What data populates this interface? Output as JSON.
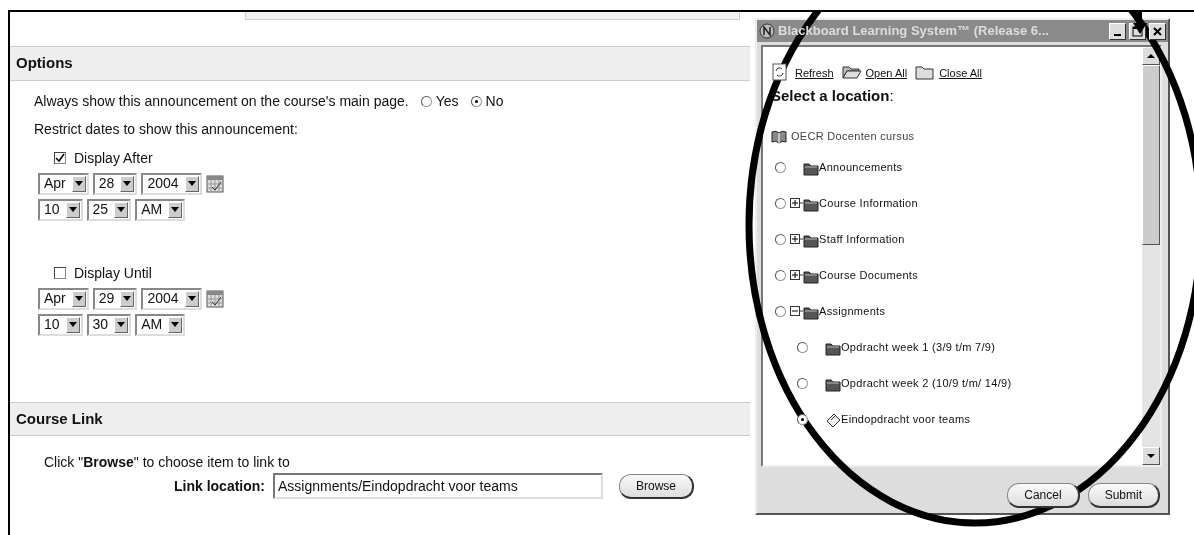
{
  "options": {
    "title": "Options",
    "always_show": {
      "label": "Always show this announcement on the course's main page.",
      "choices": [
        {
          "label": "Yes",
          "selected": false
        },
        {
          "label": "No",
          "selected": true
        }
      ]
    },
    "restrict_label": "Restrict dates to show this announcement:",
    "ranges": [
      {
        "label": "Display After",
        "checked": true,
        "date": [
          "Apr",
          "28",
          "2004"
        ],
        "time": [
          "10",
          "25",
          "AM"
        ]
      },
      {
        "label": "Display Until",
        "checked": false,
        "date": [
          "Apr",
          "29",
          "2004"
        ],
        "time": [
          "10",
          "30",
          "AM"
        ]
      }
    ]
  },
  "course_link": {
    "title": "Course Link",
    "instruction": "Click \"**Browse**\" to choose item to link to",
    "location_label": "Link location:",
    "location_value": "Assignments/Eindopdracht voor teams",
    "browse_button": "Browse"
  },
  "popup": {
    "title": "Blackboard Learning System™ (Release 6...",
    "toolbar": [
      {
        "kind": "refresh",
        "label": "Refresh"
      },
      {
        "kind": "open",
        "label": "Open All"
      },
      {
        "kind": "close",
        "label": "Close All"
      }
    ],
    "heading": "**Select a location**:",
    "tree": {
      "label": "OECR Docenten cursus",
      "children": [
        {
          "label": "Announcements",
          "kind": "folder",
          "selected": false
        },
        {
          "label": "Course Information",
          "kind": "folder",
          "selected": false,
          "expanded": false
        },
        {
          "label": "Staff Information",
          "kind": "folder",
          "selected": false,
          "expanded": false
        },
        {
          "label": "Course Documents",
          "kind": "folder",
          "selected": false,
          "expanded": false
        },
        {
          "label": "Assignments",
          "kind": "folder",
          "selected": false,
          "expanded": true,
          "children": [
            {
              "label": "Opdracht week 1 (3/9 t/m 7/9)",
              "kind": "folder",
              "selected": false
            },
            {
              "label": "Opdracht week 2 (10/9 t/m/ 14/9)",
              "kind": "folder",
              "selected": false
            },
            {
              "label": "Eindopdracht voor teams",
              "kind": "assignment",
              "selected": true
            }
          ]
        }
      ]
    },
    "buttons": [
      "Cancel",
      "Submit"
    ]
  }
}
